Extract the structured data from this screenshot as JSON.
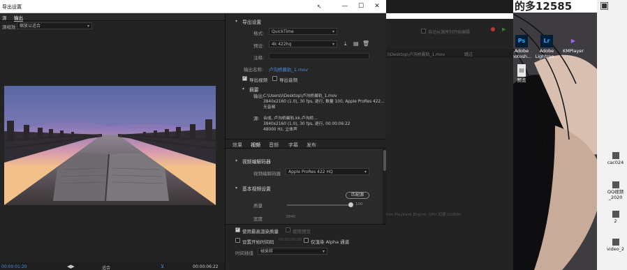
{
  "window": {
    "title": "导出设置",
    "min_label": "—",
    "max_label": "☐",
    "close_label": "✕"
  },
  "left_tabs": {
    "source": "源",
    "output": "输出"
  },
  "source_scaling": {
    "label": "源缩放",
    "value": "缩放以适合"
  },
  "timeline": {
    "start_time": "00:00:01:20",
    "end_time": "00:00:06:22",
    "fit_label": "适合"
  },
  "export_settings": {
    "header": "导出设置",
    "format_label": "格式:",
    "format_value": "QuickTime",
    "preset_label": "预设:",
    "preset_value": "4k 422hq",
    "comment_label": "注释:",
    "comment_value": "",
    "output_name_label": "输出名称:",
    "output_name_value": "卢沟桥晨轨_1.mov",
    "export_video_label": "导出视频",
    "export_audio_label": "导出音频",
    "summary_header": "摘要",
    "output_label": "输出:",
    "output_path": "C:\\Users\\l\\Desktop\\卢沟桥晨轨_1.mov",
    "output_line2": "3840x2160 (1.0), 30 fps, 逐行, 数量 100, Apple ProRes 422...",
    "output_line3": "无音频",
    "source_label": "源:",
    "source_line1": "合成, 卢沟桥晨轨.kk.卢沟桥...",
    "source_line2": "3840x2160 (1.0), 30 fps, 逐行, 00:00:06:22",
    "source_line3": "48000 Hz, 立体声"
  },
  "settings_tabs": [
    "效果",
    "视频",
    "音频",
    "字幕",
    "发布"
  ],
  "video_codec": {
    "header": "视频编解码器",
    "codec_label": "视频编解码器",
    "codec_value": "Apple ProRes 422 HQ"
  },
  "basic_video": {
    "header": "基本视频设置",
    "match_source_button": "匹配源",
    "quality_label": "质量",
    "quality_value": "100",
    "quality_level": 1.0,
    "width_label": "宽度",
    "width_value": "3840"
  },
  "bottom_options": {
    "max_render_quality": "使用最高渲染质量",
    "use_previews": "使用预览",
    "set_start_timecode": "设置开始时间码",
    "start_timecode_value": "00:00:00:00",
    "render_alpha_only": "仅渲染 Alpha 通道",
    "time_interpolation_label": "时间插值",
    "time_interpolation_value": "帧采样"
  },
  "background_app": {
    "path_text": "l\\Desktop\\卢沟桥晨轨_1.mov",
    "status_text": "跳过",
    "checkbox_text": "自动从源序列开始编辑",
    "footer_text": "tion Playback Engine: GPU 加速 (CUDA)"
  },
  "desktop": {
    "banner_text": "的多12585",
    "icons": [
      {
        "name": "Adobe hotosh...",
        "glyph": "Ps",
        "color": "#001e36",
        "fg": "#31a8ff"
      },
      {
        "name": "Adobe Lightroo...",
        "glyph": "Lr",
        "color": "#001e36",
        "fg": "#31a8ff"
      },
      {
        "name": "KMPlayer",
        "glyph": "▶",
        "color": "#3a2a4a",
        "fg": "#a060ff"
      },
      {
        "name": "预览",
        "glyph": "▤",
        "color": "#e8e8e8",
        "fg": "#666"
      }
    ],
    "side_labels": [
      "cac024",
      "QQ视频_2020",
      "2",
      "video_2"
    ]
  }
}
